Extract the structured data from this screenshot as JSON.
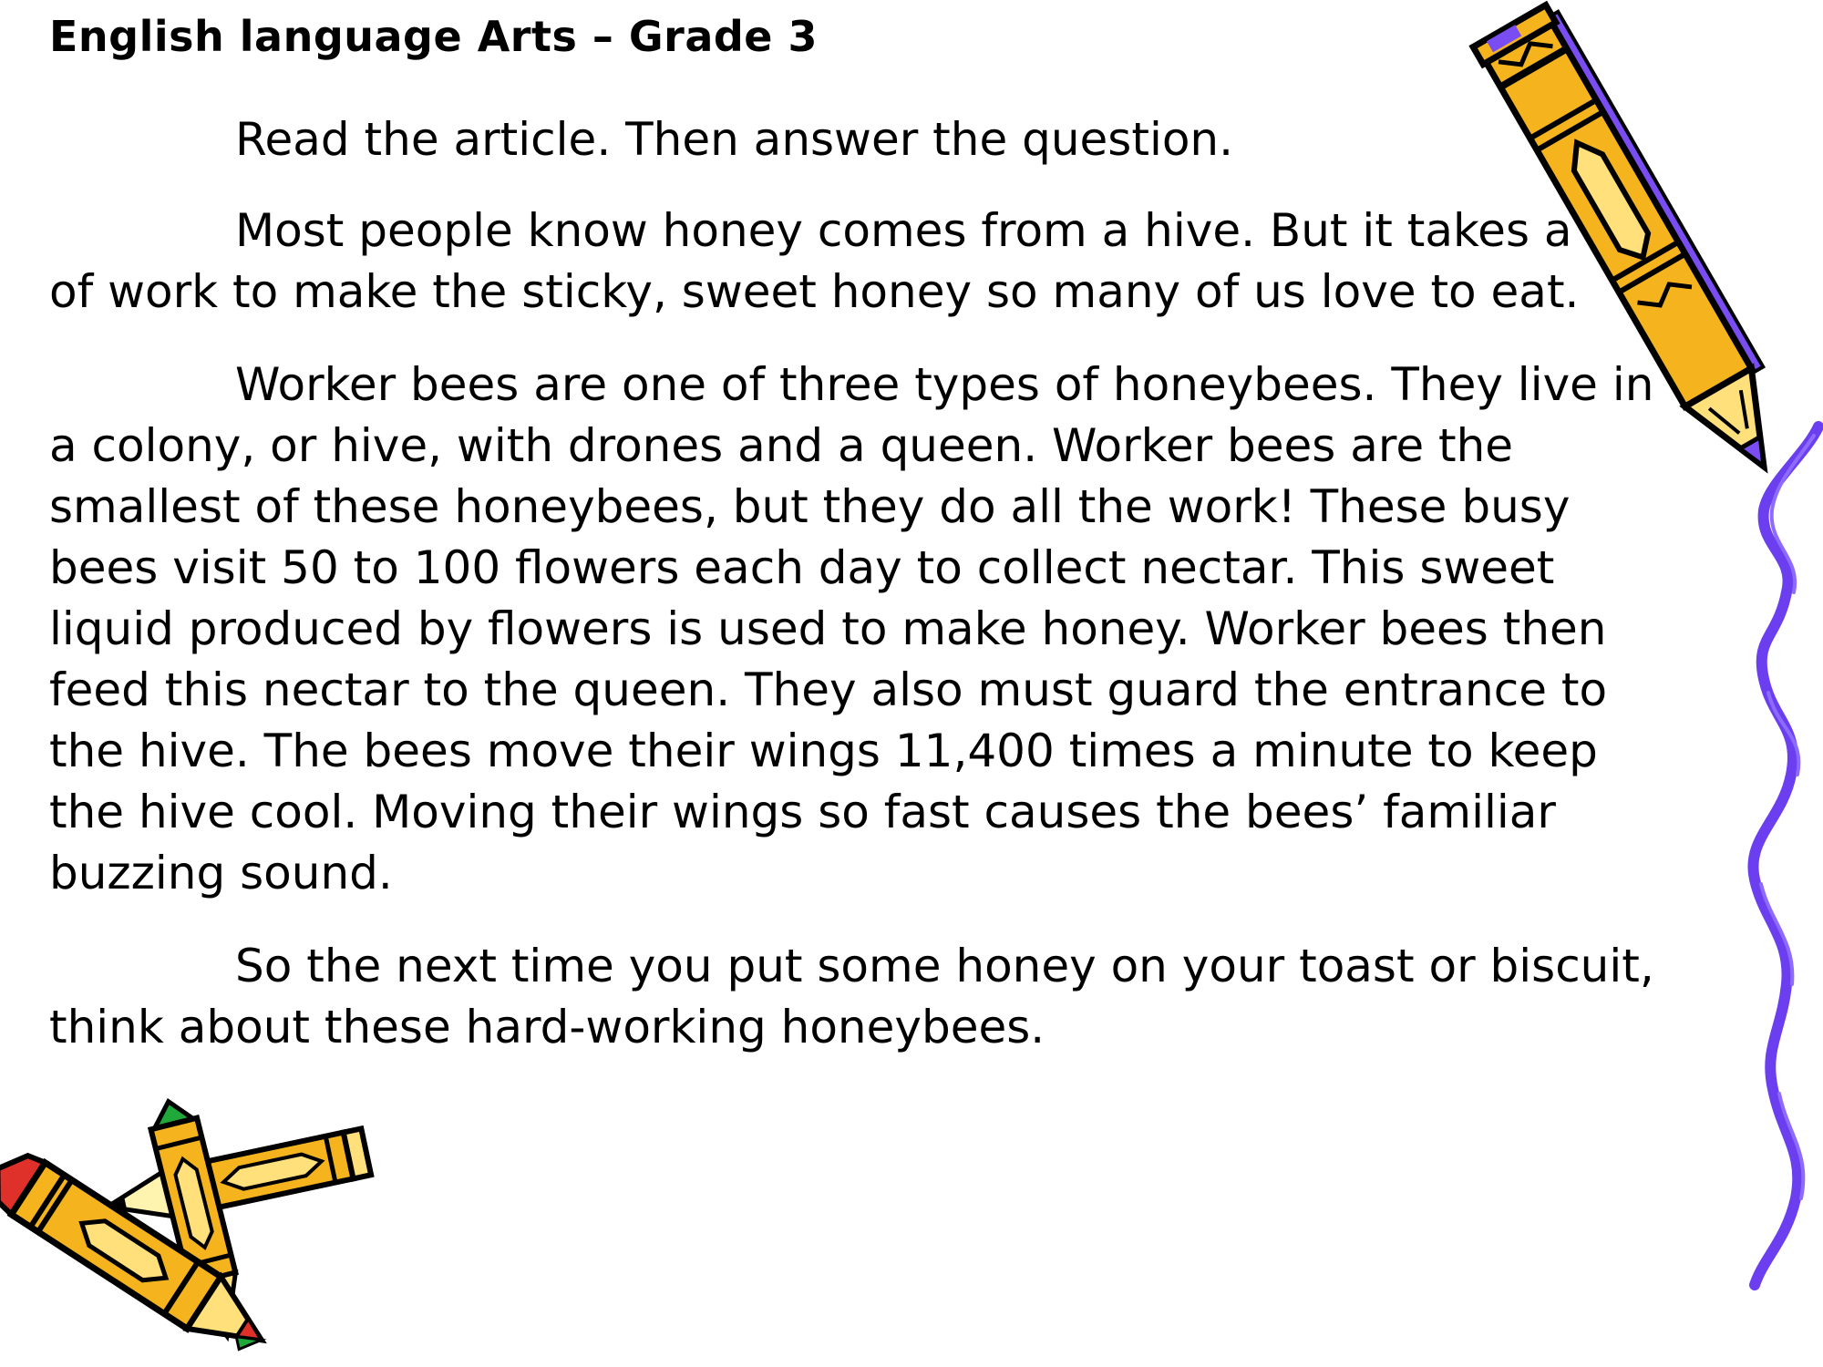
{
  "header": {
    "title": "English language Arts – Grade 3"
  },
  "article": {
    "instruction": "Read the article.  Then answer the question.",
    "paragraphs": [
      "Most people know honey comes from a hive.  But it takes a lot of work to make the sticky, sweet honey so many of us love to eat.",
      "Worker bees are one of three types of honeybees.  They live in a colony, or hive, with drones and a queen.  Worker bees are the smallest of these honeybees, but they do all the work!  These busy bees visit 50 to 100 flowers each day to collect nectar.  This sweet liquid produced by flowers is used to make honey.  Worker bees then feed this nectar to the queen.  They also must guard the entrance to the hive.  The bees move their wings 11,400 times a minute to keep the hive cool.  Moving their wings so fast causes the bees’ familiar buzzing sound.",
      "So the next time you put some honey on your toast or biscuit, think about these hard-working honeybees."
    ]
  },
  "decorations": {
    "top_right": "pencil-clipart",
    "right_edge": "squiggle-line-clipart",
    "bottom_left": "crossed-pencils-clipart"
  },
  "colors": {
    "pencil_body": "#F5B41E",
    "pencil_shade": "#FFE07A",
    "squiggle": "#6B3FF0",
    "eraser_purple": "#7A4DF2",
    "tip_red": "#E0302A",
    "tip_green": "#21A83A",
    "outline": "#000000"
  }
}
